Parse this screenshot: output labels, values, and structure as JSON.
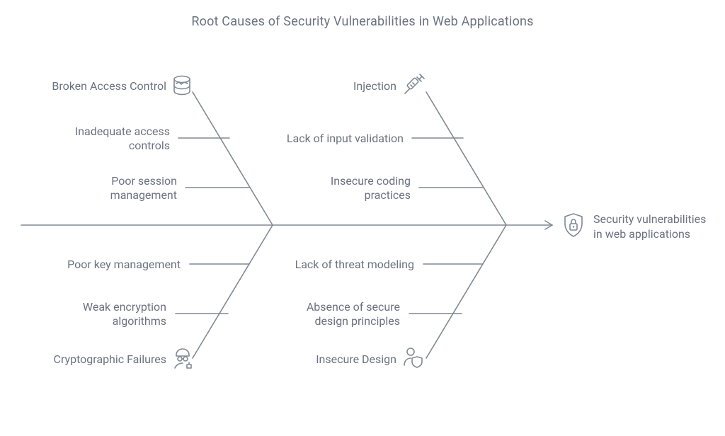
{
  "title": "Root Causes of Security Vulnerabilities in Web Applications",
  "outcome": {
    "line1": "Security vulnerabilities",
    "line2": "in web applications"
  },
  "bones": {
    "topLeft": {
      "category": "Broken Access Control",
      "sub1": "Inadequate access controls",
      "sub2": "Poor session management"
    },
    "topRight": {
      "category": "Injection",
      "sub1": "Lack of input validation",
      "sub2": "Insecure coding practices"
    },
    "bottomLeft": {
      "category": "Cryptographic Failures",
      "sub1": "Poor key management",
      "sub2": "Weak encryption algorithms"
    },
    "bottomRight": {
      "category": "Insecure Design",
      "sub1": "Lack of threat modeling",
      "sub2": "Absence of secure design principles"
    }
  },
  "icons": {
    "topLeft": "database-broken-icon",
    "topRight": "syringe-icon",
    "bottomLeft": "hacker-icon",
    "bottomRight": "user-shield-icon",
    "outcome": "shield-lock-icon"
  },
  "colors": {
    "line": "#808993",
    "text": "#6b7280",
    "background": "#ffffff"
  }
}
